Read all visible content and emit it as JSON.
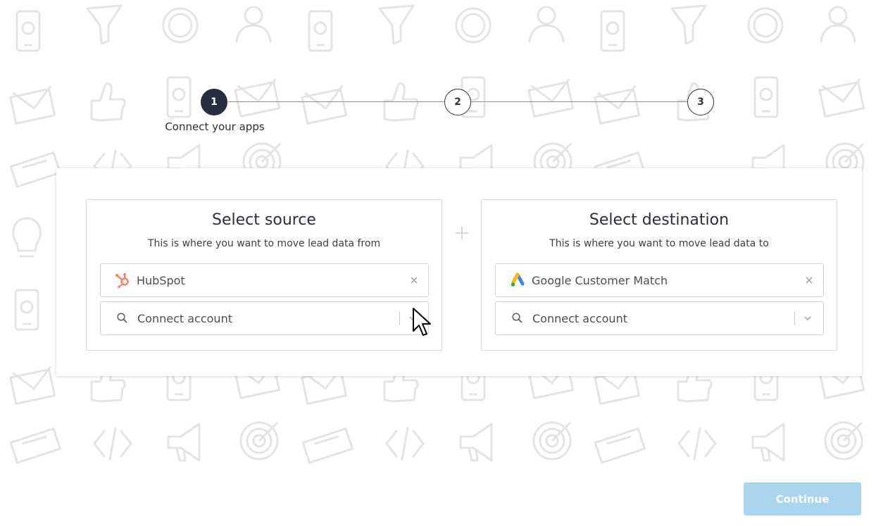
{
  "stepper": {
    "steps": [
      {
        "number": "1",
        "label": "Connect your apps",
        "active": true
      },
      {
        "number": "2",
        "active": false
      },
      {
        "number": "3",
        "active": false
      }
    ]
  },
  "source": {
    "title": "Select source",
    "subtitle": "This is where you want to move lead data from",
    "app": {
      "name": "HubSpot",
      "icon": "hubspot-logo-icon"
    },
    "account_placeholder": "Connect account"
  },
  "destination": {
    "title": "Select destination",
    "subtitle": "This is where you want to move lead data to",
    "app": {
      "name": "Google Customer Match",
      "icon": "google-ads-logo-icon"
    },
    "account_placeholder": "Connect account"
  },
  "footer": {
    "continue_label": "Continue"
  },
  "colors": {
    "step_active": "#243042",
    "continue_disabled": "#a9d5ef",
    "hubspot_orange": "#ff7a59",
    "google_blue": "#4285f4",
    "google_yellow": "#fbbc04",
    "google_green": "#34a853",
    "pattern": "#e6e6e6"
  }
}
